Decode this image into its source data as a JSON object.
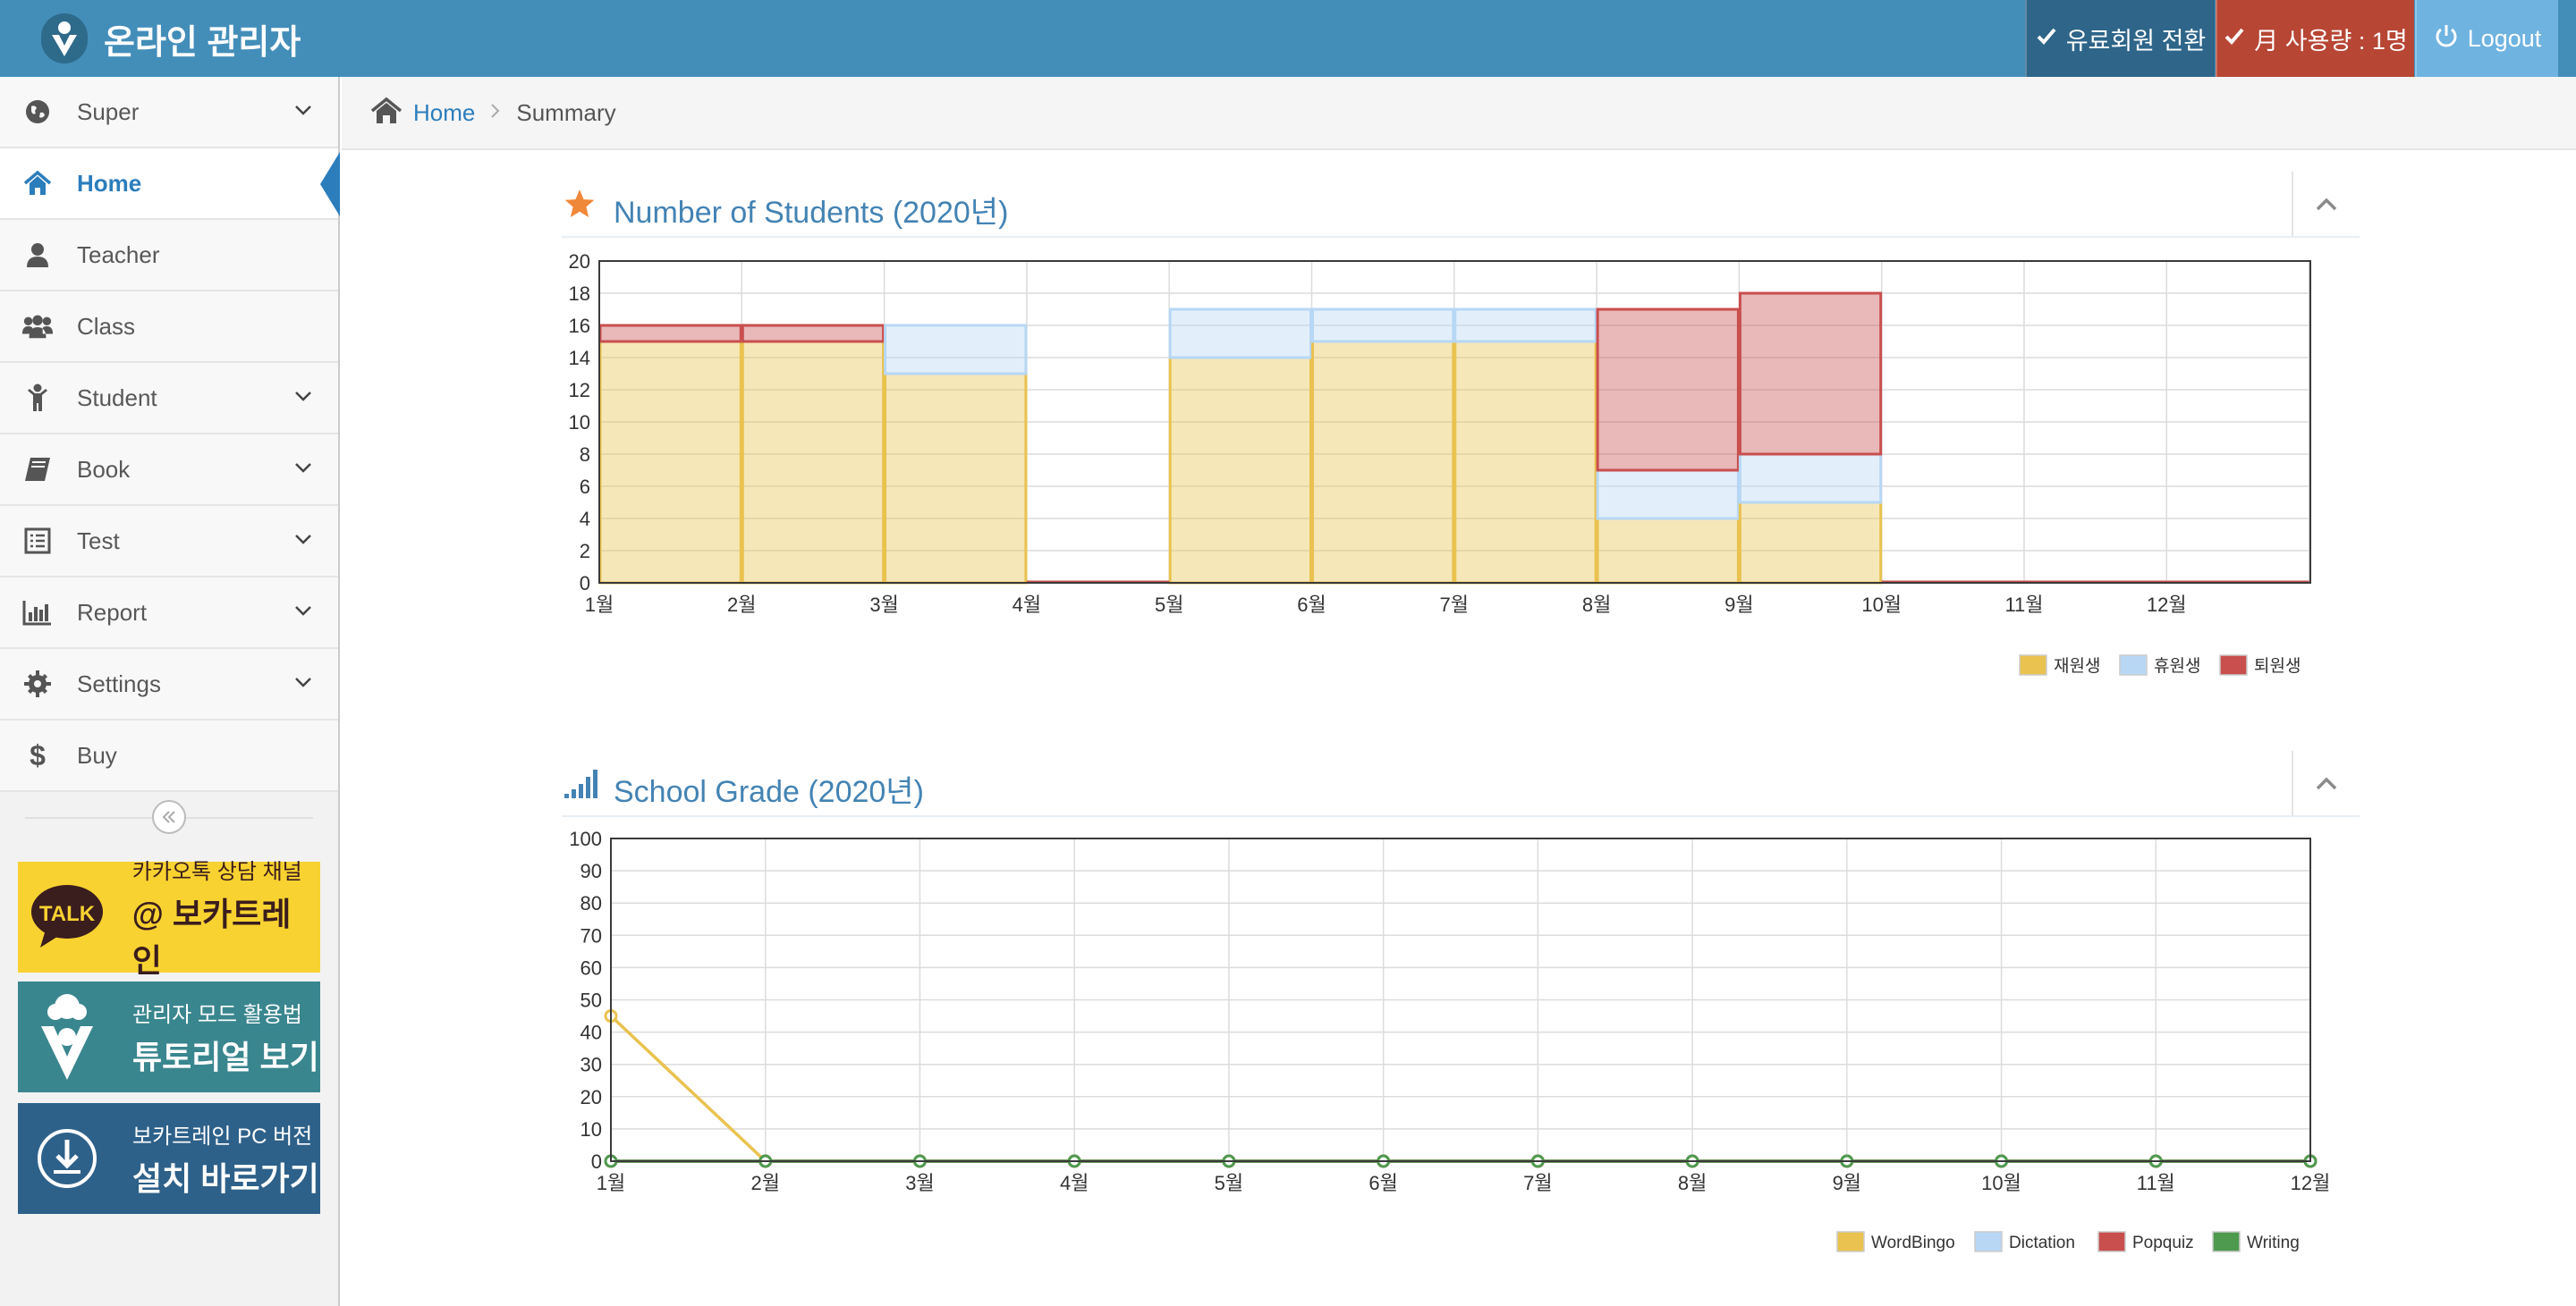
{
  "header": {
    "title": "온라인 관리자",
    "upgrade_label": "유료회원 전환",
    "usage_label": "月 사용량 : 1명",
    "logout_label": "Logout",
    "colors": {
      "bar": "#438eb9",
      "upgrade": "#2e6589",
      "usage": "#b74635",
      "logout": "#6fb3e0"
    }
  },
  "sidebar": {
    "items": [
      {
        "label": "Super",
        "icon": "globe-icon",
        "has_submenu": true
      },
      {
        "label": "Home",
        "icon": "home-icon",
        "has_submenu": false,
        "active": true
      },
      {
        "label": "Teacher",
        "icon": "user-icon",
        "has_submenu": false
      },
      {
        "label": "Class",
        "icon": "users-icon",
        "has_submenu": false
      },
      {
        "label": "Student",
        "icon": "child-icon",
        "has_submenu": true
      },
      {
        "label": "Book",
        "icon": "book-icon",
        "has_submenu": true
      },
      {
        "label": "Test",
        "icon": "list-icon",
        "has_submenu": true
      },
      {
        "label": "Report",
        "icon": "bar-chart-icon",
        "has_submenu": true
      },
      {
        "label": "Settings",
        "icon": "gear-icon",
        "has_submenu": true
      },
      {
        "label": "Buy",
        "icon": "dollar-icon",
        "has_submenu": false
      }
    ],
    "collapse_icon": "double-chevron-left-icon"
  },
  "banners": {
    "kakao": {
      "small": "카카오톡 상담 채널",
      "big": "@ 보카트레인",
      "badge": "TALK"
    },
    "tutorial": {
      "small": "관리자 모드 활용법",
      "big": "튜토리얼 보기"
    },
    "install": {
      "small": "보카트레인 PC 버전",
      "big": "설치 바로가기"
    }
  },
  "breadcrumb": {
    "home": "Home",
    "current": "Summary"
  },
  "widgets": {
    "students": {
      "title": "Number of Students (2020년)",
      "icon": "star-icon"
    },
    "grades": {
      "title": "School Grade (2020년)",
      "icon": "signal-icon"
    }
  },
  "chart_data": [
    {
      "type": "bar",
      "stacked": true,
      "categories": [
        "1월",
        "2월",
        "3월",
        "4월",
        "5월",
        "6월",
        "7월",
        "8월",
        "9월",
        "10월",
        "11월",
        "12월"
      ],
      "series": [
        {
          "name": "재원생",
          "color": "#e9c24f",
          "values": [
            15,
            15,
            13,
            0,
            14,
            15,
            15,
            4,
            5,
            0,
            0,
            0
          ]
        },
        {
          "name": "휴원생",
          "color": "#b7d7f4",
          "values": [
            0,
            0,
            3,
            0,
            3,
            2,
            2,
            3,
            3,
            0,
            0,
            0
          ]
        },
        {
          "name": "퇴원생",
          "color": "#c94e4e",
          "values": [
            1,
            1,
            0,
            0,
            0,
            0,
            0,
            10,
            10,
            0,
            0,
            0
          ]
        }
      ],
      "ylim": [
        0,
        20
      ],
      "yticks": [
        0,
        2,
        4,
        6,
        8,
        10,
        12,
        14,
        16,
        18,
        20
      ],
      "legend": "bottom-right",
      "grid": true
    },
    {
      "type": "line",
      "categories": [
        "1월",
        "2월",
        "3월",
        "4월",
        "5월",
        "6월",
        "7월",
        "8월",
        "9월",
        "10월",
        "11월",
        "12월"
      ],
      "series": [
        {
          "name": "WordBingo",
          "color": "#e9c24f",
          "values": [
            45,
            0,
            0,
            0,
            0,
            0,
            0,
            0,
            0,
            0,
            0,
            0
          ]
        },
        {
          "name": "Dictation",
          "color": "#b7d7f4",
          "values": [
            0,
            0,
            0,
            0,
            0,
            0,
            0,
            0,
            0,
            0,
            0,
            0
          ]
        },
        {
          "name": "Popquiz",
          "color": "#c94e4e",
          "values": [
            0,
            0,
            0,
            0,
            0,
            0,
            0,
            0,
            0,
            0,
            0,
            0
          ]
        },
        {
          "name": "Writing",
          "color": "#4e9a4e",
          "values": [
            0,
            0,
            0,
            0,
            0,
            0,
            0,
            0,
            0,
            0,
            0,
            0
          ]
        }
      ],
      "ylim": [
        0,
        100
      ],
      "yticks": [
        0,
        10,
        20,
        30,
        40,
        50,
        60,
        70,
        80,
        90,
        100
      ],
      "legend": "bottom-right",
      "grid": true
    }
  ]
}
